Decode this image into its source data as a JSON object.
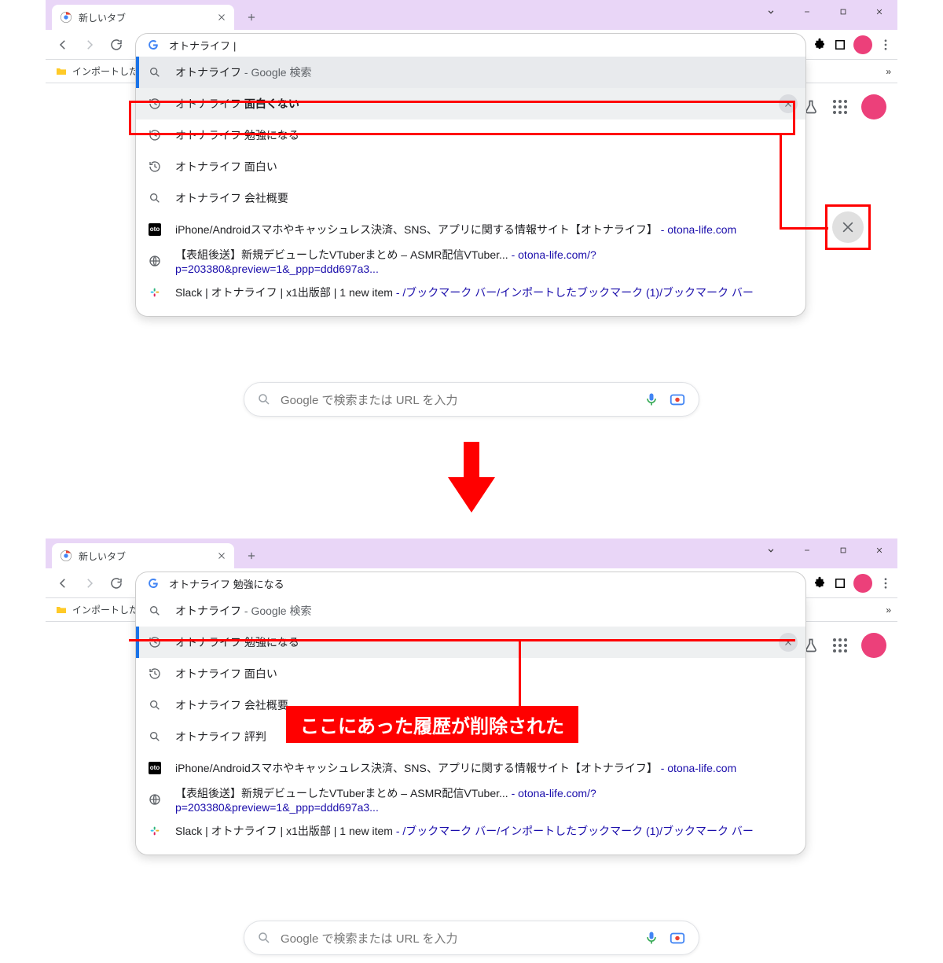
{
  "window1": {
    "tab_title": "新しいタブ",
    "bookmark_bar": "インポートした…",
    "omnibox_value": "オトナライフ",
    "suggestions": [
      {
        "icon": "search",
        "pre": "オトナライフ",
        "post": " - Google 検索"
      },
      {
        "icon": "history",
        "text": "オトナライフ 面白くない",
        "hl": true,
        "removable": true
      },
      {
        "icon": "history",
        "text": "オトナライフ 勉強になる"
      },
      {
        "icon": "history",
        "text": "オトナライフ 面白い"
      },
      {
        "icon": "search",
        "text": "オトナライフ 会社概要"
      },
      {
        "icon": "oto",
        "text": "iPhone/Androidスマホやキャッシュレス決済、SNS、アプリに関する情報サイト【オトナライフ】",
        "url": " - otona-life.com"
      },
      {
        "icon": "globe",
        "text": "【表組後送】新規デビューしたVTuberまとめ – ASMR配信VTuber...",
        "url": " - otona-life.com/?p=203380&preview=1&_ppp=ddd697a3..."
      },
      {
        "icon": "slack",
        "text": "Slack | オトナライフ | x1出版部 | 1 new item",
        "url": " - /ブックマーク バー/インポートしたブックマーク (1)/ブックマーク バー"
      }
    ],
    "ntp_placeholder": "Google で検索または URL を入力"
  },
  "window2": {
    "tab_title": "新しいタブ",
    "bookmark_bar": "インポートした…",
    "omnibox_value": "オトナライフ 勉強になる",
    "suggestions": [
      {
        "icon": "search",
        "pre": "オトナライフ",
        "post": " - Google 検索"
      },
      {
        "icon": "history",
        "text": "オトナライフ 勉強になる",
        "hl": true,
        "removable": true
      },
      {
        "icon": "history",
        "text": "オトナライフ 面白い"
      },
      {
        "icon": "search",
        "text": "オトナライフ 会社概要"
      },
      {
        "icon": "search",
        "text": "オトナライフ 評判"
      },
      {
        "icon": "oto",
        "text": "iPhone/Androidスマホやキャッシュレス決済、SNS、アプリに関する情報サイト【オトナライフ】",
        "url": " - otona-life.com"
      },
      {
        "icon": "globe",
        "text": "【表組後送】新規デビューしたVTuberまとめ – ASMR配信VTuber...",
        "url": " - otona-life.com/?p=203380&preview=1&_ppp=ddd697a3..."
      },
      {
        "icon": "slack",
        "text": "Slack | オトナライフ | x1出版部 | 1 new item",
        "url": " - /ブックマーク バー/インポートしたブックマーク (1)/ブックマーク バー"
      }
    ],
    "ntp_placeholder": "Google で検索または URL を入力"
  },
  "annotation": "ここにあった履歴が削除された"
}
